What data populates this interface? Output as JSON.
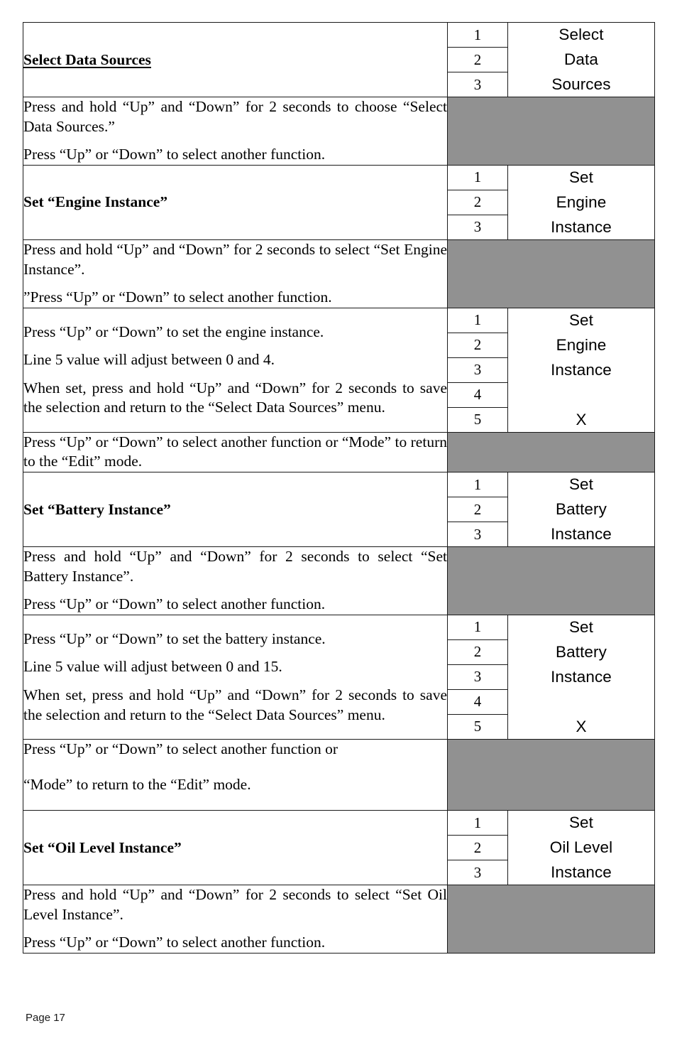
{
  "document": {
    "page_label": "Page 17",
    "grey_fill": "#919191",
    "border_color": "#1a1a1a"
  },
  "sections": [
    {
      "id": "select-data-sources",
      "heading": "Select Data Sources",
      "module": {
        "lines": [
          "1",
          "2",
          "3"
        ],
        "display": [
          "Select",
          "Data",
          "Sources"
        ]
      }
    },
    {
      "id": "select-data-sources-notes",
      "paragraphs": [
        "Press and hold “Up” and “Down” for 2 seconds to choose “Select Data Sources.”",
        "Press “Up” or “Down” to select another function."
      ]
    },
    {
      "id": "set-engine-instance",
      "heading": "Set “Engine Instance”",
      "module": {
        "lines": [
          "1",
          "2",
          "3"
        ],
        "display": [
          "Set",
          "Engine",
          "Instance"
        ]
      }
    },
    {
      "id": "set-engine-instance-notes",
      "paragraphs": [
        "Press and hold “Up” and “Down” for 2 seconds to select “Set Engine Instance”.",
        "”Press “Up” or “Down” to select another function."
      ]
    },
    {
      "id": "engine-instance-adjust",
      "paragraphs": [
        "Press “Up” or “Down” to set the engine instance.",
        "Line 5 value will adjust between 0 and 4.",
        "When set, press and hold “Up” and “Down” for 2 seconds to save the selection and return to the “Select Data Sources” menu."
      ],
      "module": {
        "lines": [
          "1",
          "2",
          "3",
          "4",
          "5"
        ],
        "display": [
          "Set",
          "Engine",
          "Instance",
          "",
          "X"
        ]
      }
    },
    {
      "id": "engine-instance-exit",
      "paragraphs": [
        "Press “Up” or “Down” to select another function or  “Mode” to return to the “Edit” mode."
      ]
    },
    {
      "id": "set-battery-instance",
      "heading": "Set “Battery Instance”",
      "module": {
        "lines": [
          "1",
          "2",
          "3"
        ],
        "display": [
          "Set",
          "Battery",
          "Instance"
        ]
      }
    },
    {
      "id": "set-battery-instance-notes",
      "paragraphs": [
        "Press and hold “Up” and “Down” for 2 seconds to select “Set Battery Instance”.",
        "Press “Up” or “Down” to select another function."
      ]
    },
    {
      "id": "battery-instance-adjust",
      "paragraphs": [
        "Press “Up” or “Down” to set the battery instance.",
        "Line 5 value will adjust between 0 and 15.",
        "When set, press and hold “Up” and “Down” for 2 seconds to save the selection and return to the “Select Data Sources” menu."
      ],
      "module": {
        "lines": [
          "1",
          "2",
          "3",
          "4",
          "5"
        ],
        "display": [
          "Set",
          "Battery",
          "Instance",
          "",
          "X"
        ]
      }
    },
    {
      "id": "battery-instance-exit",
      "paragraphs": [
        "Press “Up” or “Down” to select another function or",
        "“Mode” to return to the “Edit” mode."
      ]
    },
    {
      "id": "set-oil-level-instance",
      "heading": "Set “Oil Level Instance”",
      "module": {
        "lines": [
          "1",
          "2",
          "3"
        ],
        "display": [
          "Set",
          "Oil Level",
          "Instance"
        ]
      }
    },
    {
      "id": "set-oil-level-instance-notes",
      "paragraphs": [
        "Press and hold “Up” and “Down” for 2 seconds to select “Set Oil Level Instance”.",
        "Press “Up” or “Down” to select another function."
      ]
    }
  ]
}
